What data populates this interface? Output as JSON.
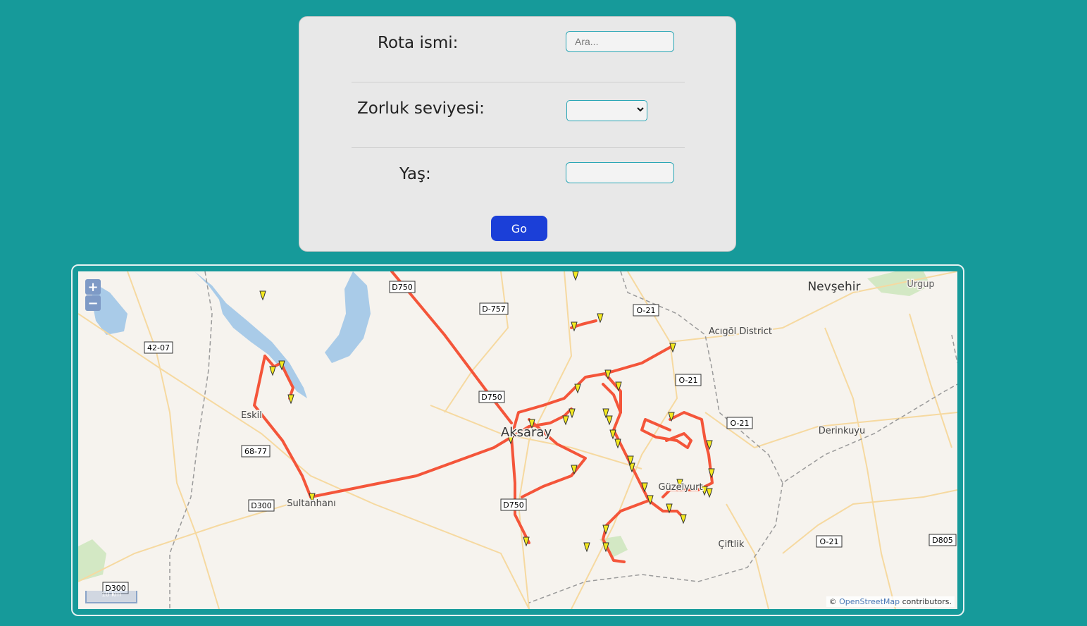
{
  "form": {
    "route_name_label": "Rota ismi:",
    "route_name_placeholder": "Ara...",
    "route_name_value": "",
    "difficulty_label": "Zorluk seviyesi:",
    "difficulty_selected": "",
    "age_label": "Yaş:",
    "age_value": "",
    "go_label": "Go"
  },
  "map": {
    "zoom_in_label": "+",
    "zoom_out_label": "−",
    "scale_label": "10 km",
    "attribution_prefix": "© ",
    "attribution_link": "OpenStreetMap",
    "attribution_suffix": " contributors.",
    "route_color": "#f4553a",
    "marker_color": "#f3e81f",
    "places": [
      "Nevşehir",
      "Urgup",
      "Acıgöl District",
      "Eskil",
      "Aksaray",
      "Sultanhanı",
      "Derinkuyu",
      "Güzelyurt",
      "Çiftlik"
    ],
    "road_labels": [
      "D750",
      "D-757",
      "O-21",
      "42-07",
      "D750",
      "O-21",
      "O-21",
      "68-77",
      "D300",
      "D750",
      "O-21",
      "D805",
      "D300"
    ]
  }
}
